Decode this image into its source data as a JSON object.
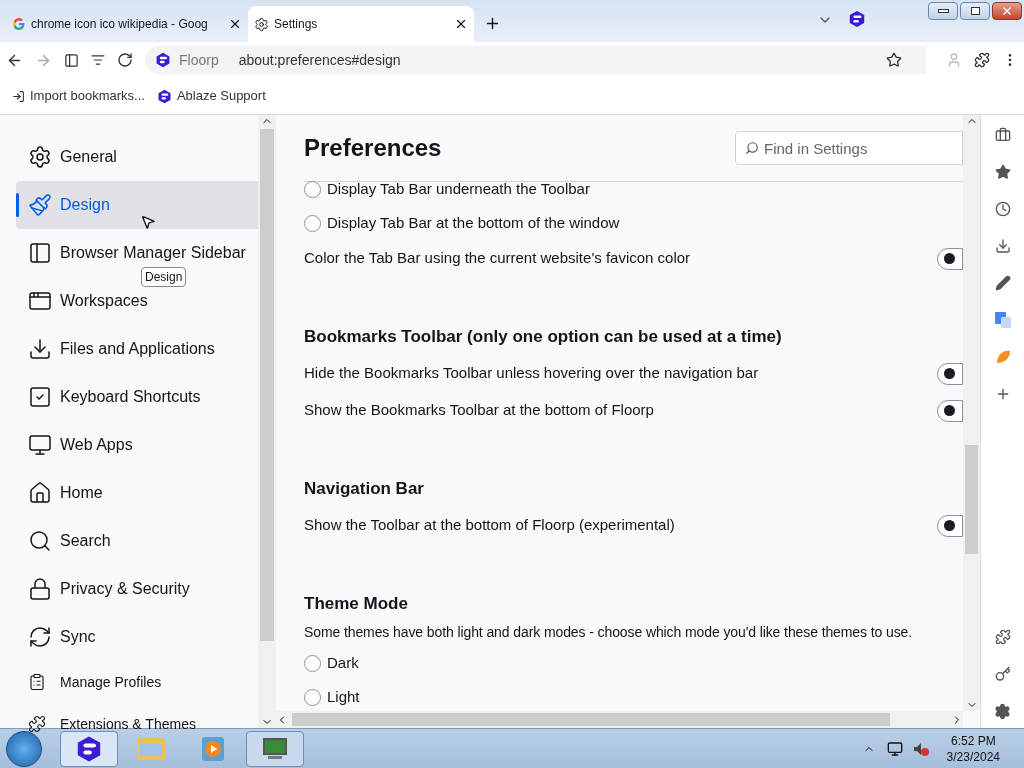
{
  "tabs": [
    {
      "title": "chrome icon ico wikipedia - Goog",
      "selected": false
    },
    {
      "title": "Settings",
      "selected": true
    }
  ],
  "toolbar": {
    "identity": "Floorp",
    "url": "about:preferences#design"
  },
  "bookmarks": [
    {
      "label": "Import bookmarks...",
      "kind": "import"
    },
    {
      "label": "Ablaze Support",
      "kind": "floorp"
    }
  ],
  "sidebar": {
    "items": [
      {
        "label": "General",
        "selected": false,
        "kind": "main"
      },
      {
        "label": "Design",
        "selected": true,
        "kind": "main"
      },
      {
        "label": "Browser Manager Sidebar",
        "selected": false,
        "kind": "main"
      },
      {
        "label": "Workspaces",
        "selected": false,
        "kind": "main"
      },
      {
        "label": "Files and Applications",
        "selected": false,
        "kind": "main"
      },
      {
        "label": "Keyboard Shortcuts",
        "selected": false,
        "kind": "main"
      },
      {
        "label": "Web Apps",
        "selected": false,
        "kind": "main"
      },
      {
        "label": "Home",
        "selected": false,
        "kind": "main"
      },
      {
        "label": "Search",
        "selected": false,
        "kind": "main"
      },
      {
        "label": "Privacy & Security",
        "selected": false,
        "kind": "main"
      },
      {
        "label": "Sync",
        "selected": false,
        "kind": "main"
      },
      {
        "label": "Manage Profiles",
        "selected": false,
        "kind": "small"
      },
      {
        "label": "Extensions & Themes",
        "selected": false,
        "kind": "small"
      }
    ]
  },
  "tooltip": "Design",
  "page": {
    "title": "Preferences",
    "search": {
      "placeholder": "Find in Settings"
    },
    "rows": [
      {
        "kind": "radio",
        "label": "Display Tab Bar underneath the Toolbar",
        "checked": false
      },
      {
        "kind": "radio",
        "label": "Display Tab Bar at the bottom of the window",
        "checked": false
      },
      {
        "kind": "toggle",
        "label": "Color the Tab Bar using the current website's favicon color",
        "on": false
      },
      {
        "kind": "heading",
        "label": "Bookmarks Toolbar (only one option can be used at a time)"
      },
      {
        "kind": "toggle",
        "label": "Hide the Bookmarks Toolbar unless hovering over the navigation bar",
        "on": false
      },
      {
        "kind": "toggle",
        "label": "Show the Bookmarks Toolbar at the bottom of Floorp",
        "on": false
      },
      {
        "kind": "heading",
        "label": "Navigation Bar"
      },
      {
        "kind": "toggle",
        "label": "Show the Toolbar at the bottom of Floorp (experimental)",
        "on": false
      },
      {
        "kind": "heading",
        "label": "Theme Mode"
      },
      {
        "kind": "text",
        "label": "Some themes have both light and dark modes - choose which mode you'd like these themes to use."
      },
      {
        "kind": "radio",
        "label": "Dark",
        "checked": false
      },
      {
        "kind": "radio",
        "label": "Light",
        "checked": false
      }
    ]
  },
  "taskbar": {
    "time": "6:52 PM",
    "date": "3/23/2024"
  }
}
